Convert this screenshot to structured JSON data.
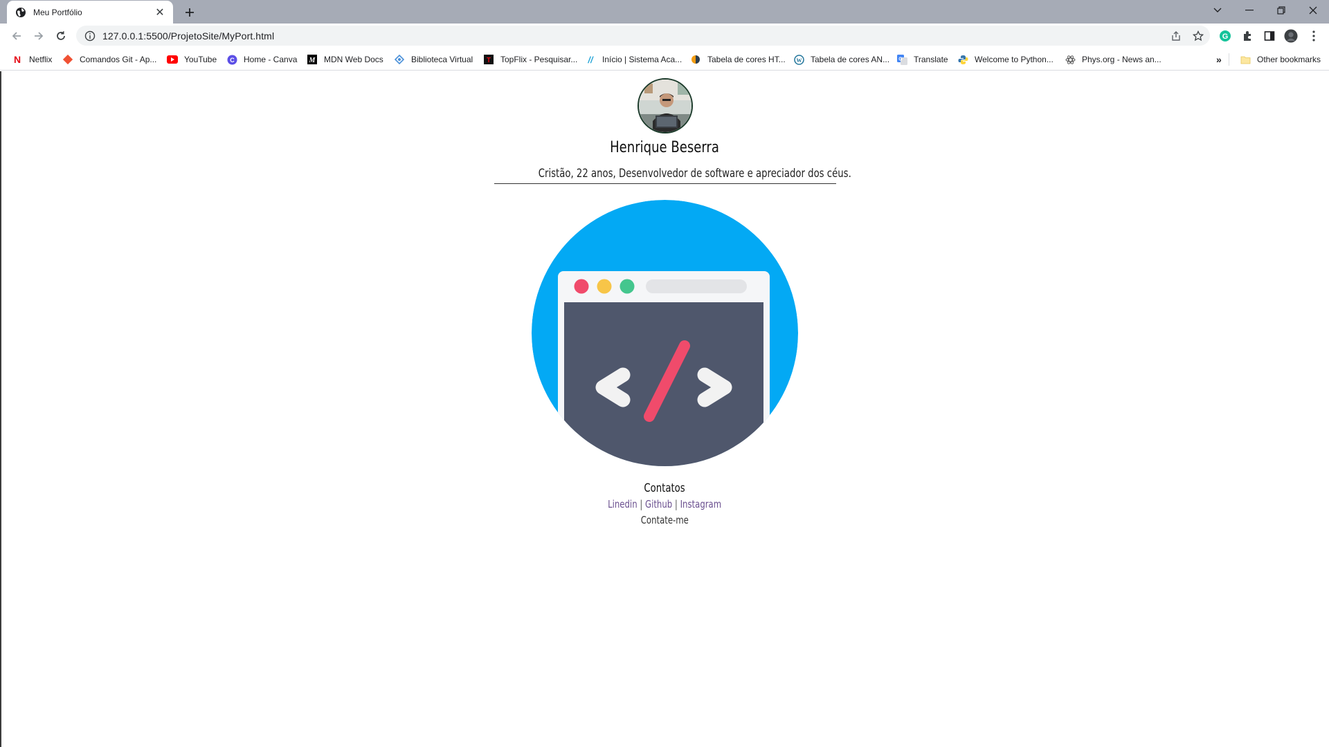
{
  "browser": {
    "tab_title": "Meu Portfólio",
    "url": "127.0.0.1:5500/ProjetoSite/MyPort.html",
    "bookmarks": [
      {
        "label": "Netflix",
        "icon": "netflix-icon"
      },
      {
        "label": "Comandos Git - Ap...",
        "icon": "git-icon"
      },
      {
        "label": "YouTube",
        "icon": "youtube-icon"
      },
      {
        "label": "Home - Canva",
        "icon": "canva-icon"
      },
      {
        "label": "MDN Web Docs",
        "icon": "mdn-icon"
      },
      {
        "label": "Biblioteca Virtual",
        "icon": "library-icon"
      },
      {
        "label": "TopFlix - Pesquisar...",
        "icon": "topflix-icon"
      },
      {
        "label": "Início | Sistema Aca...",
        "icon": "slash-icon"
      },
      {
        "label": "Tabela de cores HT...",
        "icon": "color-table-icon"
      },
      {
        "label": "Tabela de cores AN...",
        "icon": "wordpress-icon"
      },
      {
        "label": "Translate",
        "icon": "translate-icon"
      },
      {
        "label": "Welcome to Python...",
        "icon": "python-icon"
      },
      {
        "label": "Phys.org - News an...",
        "icon": "physorg-icon"
      }
    ],
    "other_bookmarks": "Other bookmarks"
  },
  "profile": {
    "name": "Henrique Beserra",
    "tagline": "Cristão, 22 anos, Desenvolvedor de software e apreciador dos céus."
  },
  "contacts": {
    "title": "Contatos",
    "links": [
      "Linedin",
      "Github",
      "Instagram"
    ],
    "separator": "|",
    "contact_me": "Contate-me"
  },
  "colors": {
    "hero_circle": "#03A9F4",
    "window_body": "#4F576C",
    "slash": "#F04B6B",
    "dot_red": "#F04B6B",
    "dot_yellow": "#F7C548",
    "dot_green": "#44C68E",
    "link": "#6A4F8F"
  }
}
